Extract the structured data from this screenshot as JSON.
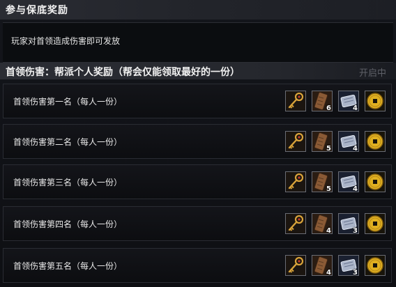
{
  "window": {
    "title": "参与保底奖励",
    "description": "玩家对首领造成伤害即可发放"
  },
  "section": {
    "title": "首领伤害：帮派个人奖励（帮会仅能领取最好的一份）",
    "status": "开启中"
  },
  "rows": [
    {
      "label": "首领伤害第一名（每人一份）",
      "rewards": [
        {
          "icon": "golden-key-icon",
          "count": ""
        },
        {
          "icon": "wooden-plank-icon",
          "count": "6"
        },
        {
          "icon": "silver-scroll-icon",
          "count": "4"
        },
        {
          "icon": "gold-coin-icon",
          "count": ""
        }
      ]
    },
    {
      "label": "首领伤害第二名（每人一份）",
      "rewards": [
        {
          "icon": "golden-key-icon",
          "count": ""
        },
        {
          "icon": "wooden-plank-icon",
          "count": "5"
        },
        {
          "icon": "silver-scroll-icon",
          "count": "4"
        },
        {
          "icon": "gold-coin-icon",
          "count": ""
        }
      ]
    },
    {
      "label": "首领伤害第三名（每人一份）",
      "rewards": [
        {
          "icon": "golden-key-icon",
          "count": ""
        },
        {
          "icon": "wooden-plank-icon",
          "count": "5"
        },
        {
          "icon": "silver-scroll-icon",
          "count": "4"
        },
        {
          "icon": "gold-coin-icon",
          "count": ""
        }
      ]
    },
    {
      "label": "首领伤害第四名（每人一份）",
      "rewards": [
        {
          "icon": "golden-key-icon",
          "count": ""
        },
        {
          "icon": "wooden-plank-icon",
          "count": "4"
        },
        {
          "icon": "silver-scroll-icon",
          "count": "3"
        },
        {
          "icon": "gold-coin-icon",
          "count": ""
        }
      ]
    },
    {
      "label": "首领伤害第五名（每人一份）",
      "rewards": [
        {
          "icon": "golden-key-icon",
          "count": ""
        },
        {
          "icon": "wooden-plank-icon",
          "count": "4"
        },
        {
          "icon": "silver-scroll-icon",
          "count": "3"
        },
        {
          "icon": "gold-coin-icon",
          "count": ""
        }
      ]
    }
  ],
  "colors": {
    "slot_border": "#6a6d75",
    "coin_gold": "#e0b020",
    "key_gold": "#d9a33a",
    "plank_brown": "#8a5a35",
    "scroll_silver": "#aab4c8"
  }
}
